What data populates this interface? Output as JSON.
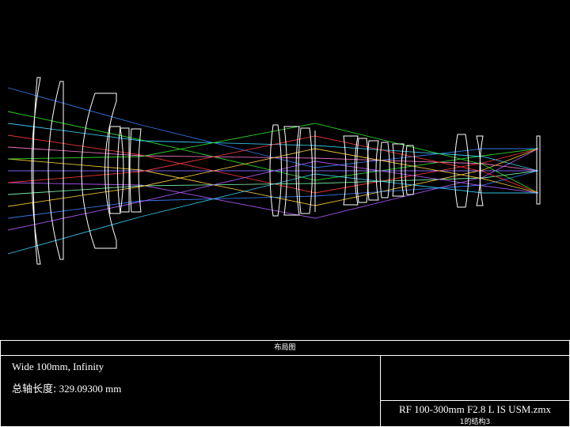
{
  "title": "布局图",
  "config_text": "Wide 100mm, Infinity",
  "total_length_label": "总轴长度:",
  "total_length_value": "329.09300 mm",
  "file_name": "RF 100-300mm F2.8 L IS USM.zmx",
  "configuration_label": "1的结构3",
  "colors": {
    "background": "#000000",
    "lens_outline": "#ffffff",
    "rays": [
      "#3b82ff",
      "#2ee62e",
      "#ff3b3b",
      "#ffd23b",
      "#b45cff",
      "#3bd6ff",
      "#ff7ad1",
      "#8a6bff",
      "#7dffb0"
    ]
  }
}
